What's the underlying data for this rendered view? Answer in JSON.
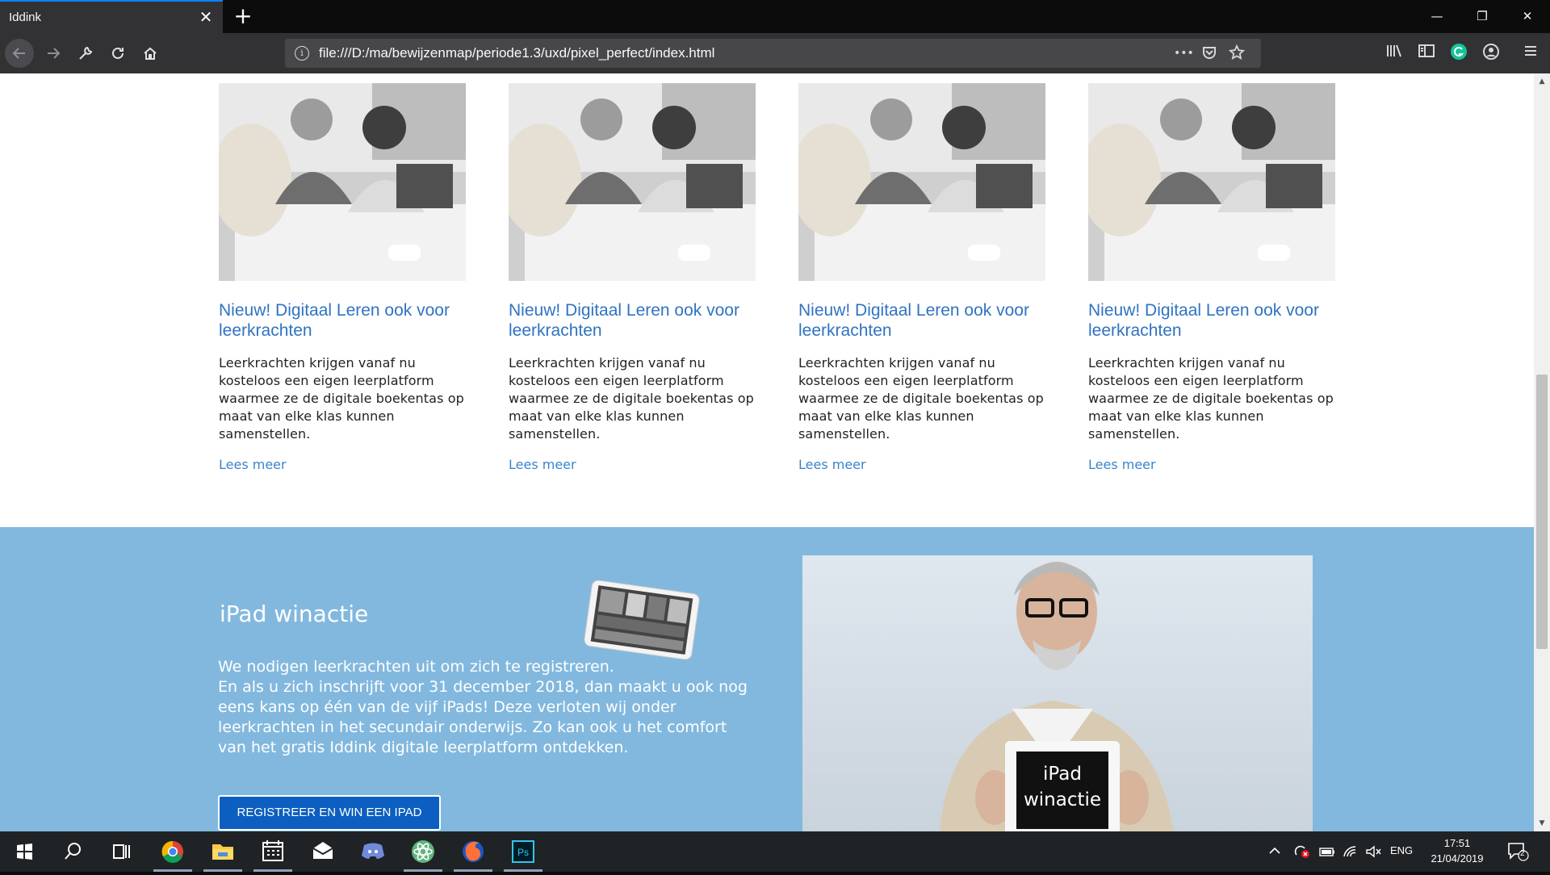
{
  "browser": {
    "tab_title": "Iddink",
    "tab_close": "✕",
    "new_tab": "+",
    "url": "file:///D:/ma/bewijzenmap/periode1.3/uxd/pixel_perfect/index.html",
    "url_info": "i",
    "page_actions": "•••",
    "window_controls": {
      "minimize": "—",
      "restore": "❐",
      "close": "✕"
    }
  },
  "news": {
    "items": [
      {
        "title": "Nieuw! Digitaal Leren ook voor leerkrachten",
        "text": "Leerkrachten krijgen vanaf nu kosteloos een eigen leerplatform waarmee ze de digitale boekentas op maat van elke klas kunnen samenstellen.",
        "link": "Lees meer"
      },
      {
        "title": "Nieuw! Digitaal Leren ook voor leerkrachten",
        "text": "Leerkrachten krijgen vanaf nu kosteloos een eigen leerplatform waarmee ze de digitale boekentas op maat van elke klas kunnen samenstellen.",
        "link": "Lees meer"
      },
      {
        "title": "Nieuw! Digitaal Leren ook voor leerkrachten",
        "text": "Leerkrachten krijgen vanaf nu kosteloos een eigen leerplatform waarmee ze de digitale boekentas op maat van elke klas kunnen samenstellen.",
        "link": "Lees meer"
      },
      {
        "title": "Nieuw! Digitaal Leren ook voor leerkrachten",
        "text": "Leerkrachten krijgen vanaf nu kosteloos een eigen leerplatform waarmee ze de digitale boekentas op maat van elke klas kunnen samenstellen.",
        "link": "Lees meer"
      }
    ]
  },
  "promo": {
    "title": "iPad winactie",
    "body_line1": "We nodigen leerkrachten uit om zich te registreren.",
    "body_line2": "En als u zich inschrijft voor 31 december 2018, dan maakt u ook nog eens kans op één van de vijf iPads! Deze verloten wij onder leerkrachten in het secundair onderwijs. Zo kan ook u het comfort van het gratis Iddink digitale leerplatform ontdekken.",
    "button": "REGISTREER EN WIN EEN IPAD",
    "sign_line1": "iPad",
    "sign_line2": "winactie"
  },
  "taskbar": {
    "language": "ENG",
    "time": "17:51",
    "date": "21/04/2019",
    "notifications": "2"
  },
  "colors": {
    "tab_accent": "#0a84ff",
    "title_link": "#2f73c3",
    "promo_bg": "#82b8de",
    "button_bg": "#0c5fc0"
  }
}
